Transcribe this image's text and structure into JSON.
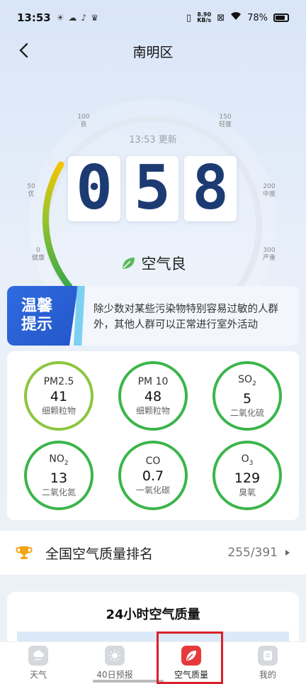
{
  "status_bar": {
    "time": "13:53",
    "speed_value": "8.90",
    "speed_unit": "KB/s",
    "battery": "78%"
  },
  "header": {
    "title": "南明区"
  },
  "gauge": {
    "update_time": "13:53 更新",
    "ticks": [
      {
        "value": "0",
        "label": "健康"
      },
      {
        "value": "50",
        "label": "优"
      },
      {
        "value": "100",
        "label": "良"
      },
      {
        "value": "150",
        "label": "轻度"
      },
      {
        "value": "200",
        "label": "中度"
      },
      {
        "value": "300",
        "label": "严重"
      }
    ],
    "aqi_digits": [
      "0",
      "5",
      "8"
    ],
    "aqi_value": 58,
    "level_text": "空气良",
    "colors": {
      "green": "#43b548",
      "yellow": "#f2c400",
      "track": "#dfe7f2"
    }
  },
  "tip": {
    "badge_line1": "温馨",
    "badge_line2": "提示",
    "text": "除少数对某些污染物特别容易过敏的人群外，其他人群可以正常进行室外活动"
  },
  "pollutants": [
    {
      "name": "PM2.5",
      "value": "41",
      "desc": "细颗粒物"
    },
    {
      "name": "PM 10",
      "value": "48",
      "desc": "细颗粒物"
    },
    {
      "name": "SO",
      "sub": "2",
      "value": "5",
      "desc": "二氧化硫"
    },
    {
      "name": "NO",
      "sub": "2",
      "value": "13",
      "desc": "二氧化氮"
    },
    {
      "name": "CO",
      "value": "0.7",
      "desc": "一氧化碳"
    },
    {
      "name": "O",
      "sub": "3",
      "value": "129",
      "desc": "臭氧"
    }
  ],
  "ranking": {
    "label": "全国空气质量排名",
    "value": "255/391"
  },
  "hours": {
    "title": "24小时空气质量"
  },
  "tabs": [
    {
      "label": "天气"
    },
    {
      "label": "40日预报"
    },
    {
      "label": "空气质量"
    },
    {
      "label": "我的"
    }
  ]
}
